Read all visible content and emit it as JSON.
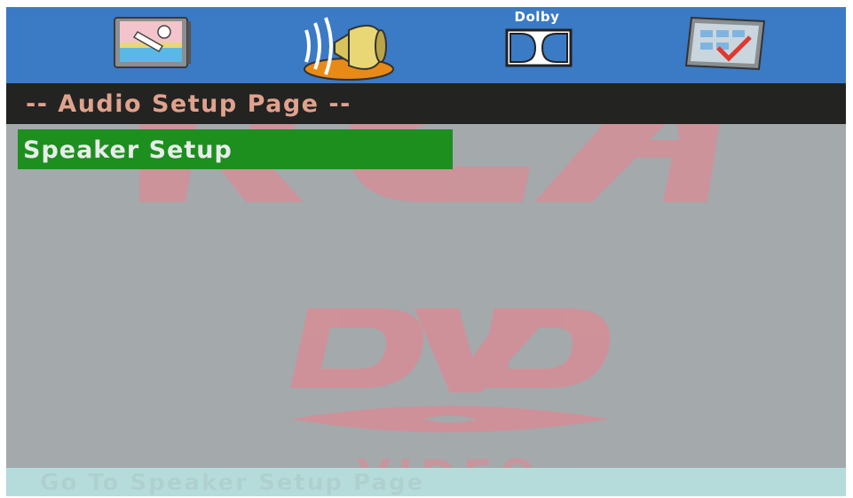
{
  "toolbar": {
    "tabs": [
      {
        "name": "general-setup",
        "icon": "monitor-wrench-icon"
      },
      {
        "name": "audio-setup",
        "icon": "speaker-icon",
        "selected": true
      },
      {
        "name": "dolby-setup",
        "icon": "dolby-icon",
        "label": "Dolby"
      },
      {
        "name": "preference-setup",
        "icon": "checklist-icon"
      }
    ]
  },
  "page": {
    "title": "-- Audio Setup Page --"
  },
  "menu": {
    "items": [
      {
        "label": "Speaker Setup",
        "selected": true
      }
    ]
  },
  "status": {
    "text": "Go To Speaker Setup Page"
  },
  "colors": {
    "toolbar_bg": "#3b7ac4",
    "title_bg": "#232322",
    "title_text": "#dfa28d",
    "selection_bg": "#1d8f1f",
    "screen_bg": "#a4a9ac",
    "status_bg": "#b5dcda",
    "watermark": "#d98c95"
  }
}
